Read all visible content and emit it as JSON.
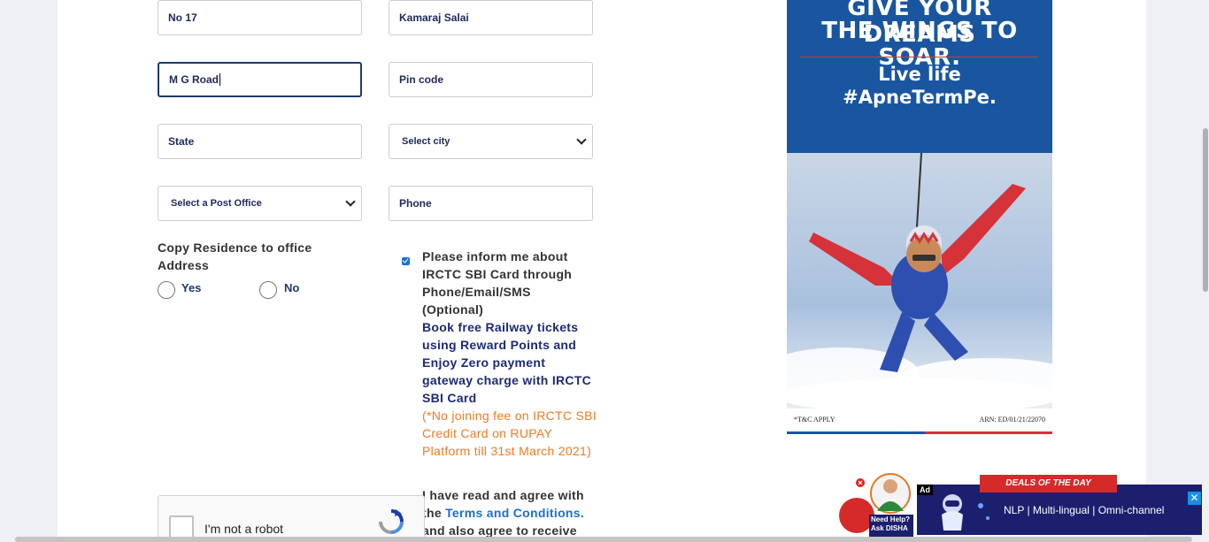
{
  "form": {
    "address_line2": "No 17",
    "street": "Kamaraj Salai",
    "area": "M G Road",
    "pincode_placeholder": "Pin code",
    "state_placeholder": "State",
    "city_select": "Select city",
    "post_office_select": "Select a Post Office",
    "phone_placeholder": "Phone",
    "copy_residence_label": "Copy Residence to office Address",
    "yes_label": "Yes",
    "no_label": "No",
    "inform_text": "Please inform me about IRCTC SBI Card through Phone/Email/SMS (Optional)",
    "book_text": "Book free Railway tickets using Reward Points and Enjoy Zero payment gateway charge with IRCTC SBI Card",
    "note_text": "(*No joining fee on IRCTC SBI Credit Card on RUPAY Platform till 31st March 2021)",
    "agree_prefix": "I have read and agree with the",
    "terms_link": "Terms and Conditions.",
    "agree_suffix": "and also agree to receive"
  },
  "recaptcha": {
    "label": "I'm not a robot"
  },
  "ad": {
    "headline1": "GIVE YOUR DREAMS",
    "headline2": "THE WINGS TO SOAR.",
    "sub1": "Live life",
    "sub2": "#ApneTermPe.",
    "tc": "*T&C APPLY",
    "arn": "ARN: ED/01/21/22070"
  },
  "bottom_ad": {
    "tag": "Ad",
    "deals": "DEALS OF THE DAY",
    "text": "NLP | Multi-lingual | Omni-channel",
    "close": "✕",
    "disha_text1": "Need Help?",
    "disha_text2": "Ask DISHA"
  },
  "colors": {
    "accent": "#1c3a6b",
    "link": "#1a6fd6",
    "orange": "#f47920",
    "ad_blue": "#1a56a0"
  }
}
